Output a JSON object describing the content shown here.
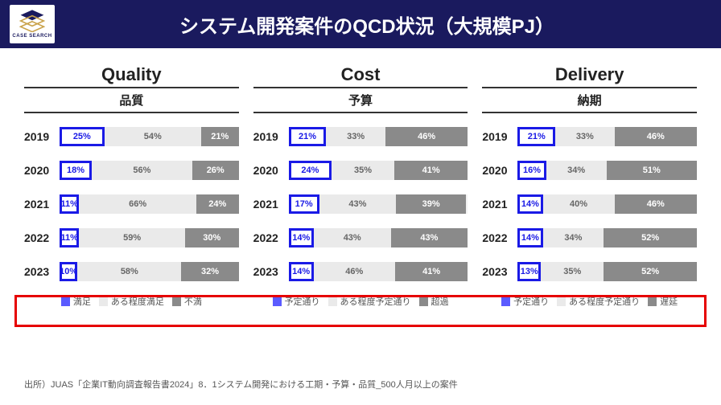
{
  "header": {
    "logo_text": "CASE SEARCH",
    "title": "システム開発案件のQCD状況（大規模PJ）"
  },
  "chart_data": [
    {
      "type": "bar",
      "stacked": true,
      "title_en": "Quality",
      "title_jp": "品質",
      "categories": [
        "2019",
        "2020",
        "2021",
        "2022",
        "2023"
      ],
      "series": [
        {
          "name": "満足",
          "values": [
            25,
            18,
            11,
            11,
            10
          ]
        },
        {
          "name": "ある程度満足",
          "values": [
            54,
            56,
            66,
            59,
            58
          ]
        },
        {
          "name": "不満",
          "values": [
            21,
            26,
            24,
            30,
            32
          ]
        }
      ],
      "legend": [
        "満足",
        "ある程度満足",
        "不満"
      ]
    },
    {
      "type": "bar",
      "stacked": true,
      "title_en": "Cost",
      "title_jp": "予算",
      "categories": [
        "2019",
        "2020",
        "2021",
        "2022",
        "2023"
      ],
      "series": [
        {
          "name": "予定通り",
          "values": [
            21,
            24,
            17,
            14,
            14
          ]
        },
        {
          "name": "ある程度予定通り",
          "values": [
            33,
            35,
            43,
            43,
            46
          ]
        },
        {
          "name": "超過",
          "values": [
            46,
            41,
            39,
            43,
            41
          ]
        }
      ],
      "legend": [
        "予定通り",
        "ある程度予定通り",
        "超過"
      ]
    },
    {
      "type": "bar",
      "stacked": true,
      "title_en": "Delivery",
      "title_jp": "納期",
      "categories": [
        "2019",
        "2020",
        "2021",
        "2022",
        "2023"
      ],
      "series": [
        {
          "name": "予定通り",
          "values": [
            21,
            16,
            14,
            14,
            13
          ]
        },
        {
          "name": "ある程度予定通り",
          "values": [
            33,
            34,
            40,
            34,
            35
          ]
        },
        {
          "name": "遅延",
          "values": [
            46,
            51,
            46,
            52,
            52
          ]
        }
      ],
      "legend": [
        "予定通り",
        "ある程度予定通り",
        "遅延"
      ]
    }
  ],
  "highlight_year": "2023",
  "source": "出所）JUAS「企業IT動向調査報告書2024」8．1システム開発における工期・予算・品質_500人月以上の案件"
}
